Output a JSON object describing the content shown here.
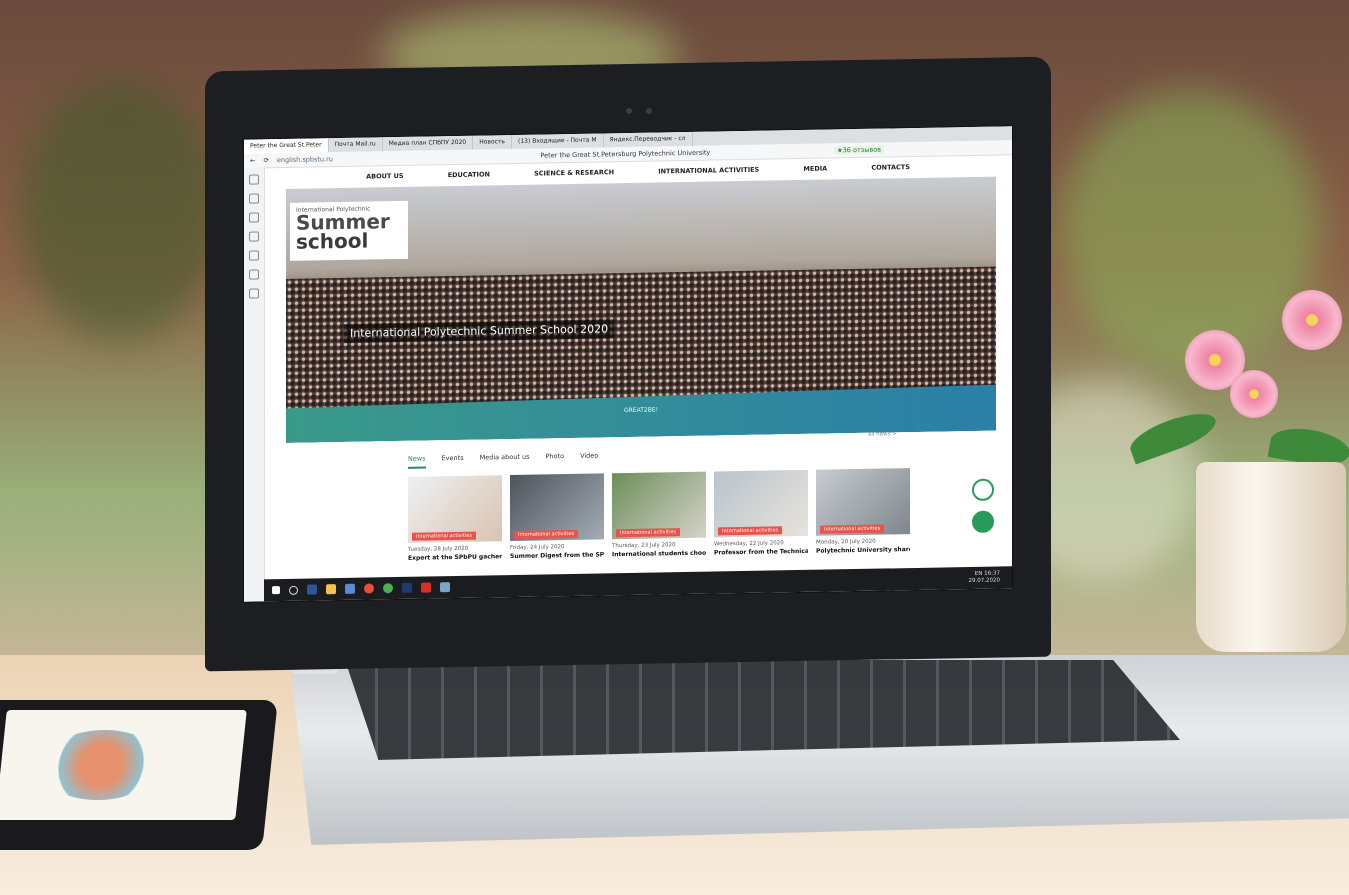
{
  "scene": {
    "colors": {
      "accent": "#2e8b57",
      "tag": "#e8534b",
      "banner": "#2b7fa8"
    }
  },
  "browser": {
    "tabs": [
      {
        "label": "Peter the Great St.Peter"
      },
      {
        "label": "Почта Mail.ru"
      },
      {
        "label": "Медиа план СПбПУ 2020"
      },
      {
        "label": "Новость"
      },
      {
        "label": "(13) Входящие - Почта М"
      },
      {
        "label": "Яндекс.Переводчик - сл"
      }
    ],
    "url": "english.spbstu.ru",
    "page_title": "Peter the Great St.Petersburg Polytechnic University",
    "reviews_badge": "★36 отзывов"
  },
  "site": {
    "nav": [
      "ABOUT US",
      "EDUCATION",
      "SCIENCE & RESEARCH",
      "INTERNATIONAL ACTIVITIES",
      "MEDIA",
      "CONTACTS"
    ],
    "logo_small": "International Polytechnic",
    "logo_line1": "Summer",
    "logo_line2": "school",
    "hero_caption": "International Polytechnic Summer School 2020",
    "banner_text": "GREAT2BE!",
    "news_tabs": [
      "News",
      "Events",
      "Media about us",
      "Photo",
      "Video"
    ],
    "all_news": "all news  >",
    "cards": [
      {
        "tag": "International activities",
        "date": "Tuesday, 28 July 2020",
        "title": "Expert at the SPbPU gachen"
      },
      {
        "tag": "International activities",
        "date": "Friday, 24 July 2020",
        "title": "Summer Digest from the SPbPU"
      },
      {
        "tag": "International activities",
        "date": "Thursday, 23 July 2020",
        "title": "International students choose"
      },
      {
        "tag": "International activities",
        "date": "Wednesday, 22 July 2020",
        "title": "Professor from the Technical"
      },
      {
        "tag": "International activities",
        "date": "Monday, 20 July 2020",
        "title": "Polytechnic University shared"
      }
    ]
  },
  "taskbar": {
    "lang": "EN",
    "time": "16:37",
    "date": "29.07.2020"
  }
}
